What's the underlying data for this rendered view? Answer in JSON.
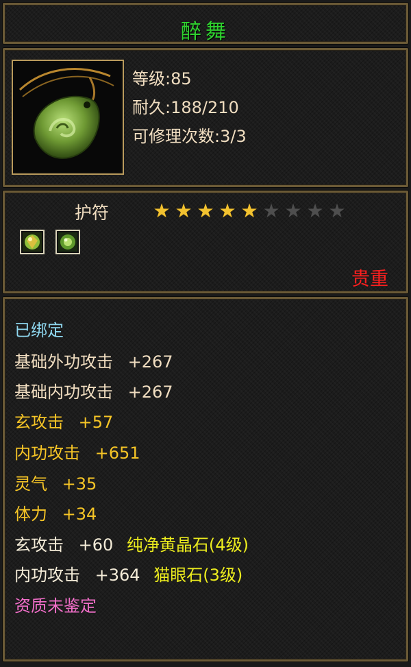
{
  "item": {
    "name": "醉舞",
    "level": "等级:85",
    "durability": "耐久:188/210",
    "repairs": "可修理次数:3/3",
    "type": "护符",
    "stars_total": 9,
    "stars_filled": 5,
    "quality": "贵重"
  },
  "gem_slots": [
    {
      "icon": "gem-slot-1-icon"
    },
    {
      "icon": "gem-slot-2-icon"
    }
  ],
  "attributes": {
    "bound": "已绑定",
    "base_outer": {
      "name": "基础外功攻击",
      "value": "+267"
    },
    "base_inner": {
      "name": "基础内功攻击",
      "value": "+267"
    },
    "mystic": {
      "name": "玄攻击",
      "value": "+57"
    },
    "inner": {
      "name": "内功攻击",
      "value": "+651"
    },
    "spirit": {
      "name": "灵气",
      "value": "+35"
    },
    "stamina": {
      "name": "体力",
      "value": "+34"
    },
    "gem1": {
      "name": "玄攻击",
      "value": "+60",
      "gem": "纯净黄晶石(4级)"
    },
    "gem2": {
      "name": "内功攻击",
      "value": "+364",
      "gem": "猫眼石(3级)"
    },
    "aptitude": "资质未鉴定"
  },
  "colors": {
    "title": "#2fd12f",
    "quality": "#ff1f1f",
    "bound": "#8fd8f0",
    "attribute": "#f6c526",
    "gem": "#ecec1e",
    "aptitude": "#f06ec8"
  }
}
